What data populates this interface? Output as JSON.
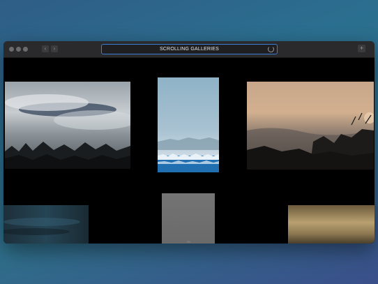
{
  "browser": {
    "url_title": "SCROLLING GALLERIES",
    "window_controls": [
      "close",
      "minimize",
      "zoom"
    ],
    "nav": {
      "back_icon": "chevron-left-icon",
      "forward_icon": "chevron-right-icon"
    },
    "new_tab_label": "+"
  },
  "gallery": {
    "photos": [
      {
        "name": "photo-foggy-forest",
        "description_icon": "landscape-photo"
      },
      {
        "name": "photo-frozen-lake",
        "description_icon": "landscape-photo"
      },
      {
        "name": "photo-misty-sunrise",
        "description_icon": "landscape-photo"
      },
      {
        "name": "photo-blurred-water",
        "description_icon": "landscape-photo"
      },
      {
        "name": "photo-gray-panel",
        "description_icon": "landscape-photo"
      },
      {
        "name": "photo-blurred-amber",
        "description_icon": "landscape-photo"
      }
    ]
  }
}
